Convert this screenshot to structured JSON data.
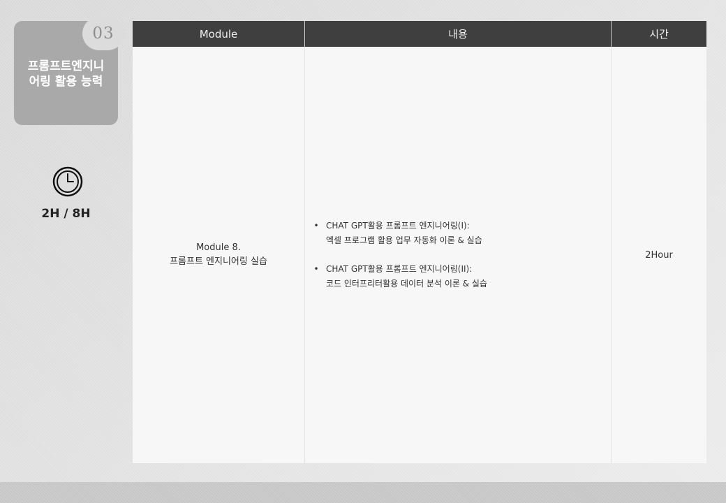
{
  "sidebar": {
    "section_number": "03",
    "title_line1": "프롬프트엔지니",
    "title_line2": "어링 활용 능력",
    "clock_icon": "clock-icon",
    "hours": "2H / 8H"
  },
  "table": {
    "headers": [
      "Module",
      "내용",
      "시간"
    ],
    "row": {
      "module_line1": "Module 8.",
      "module_line2": "프롬프트 엔지니어링 실습",
      "contents": [
        {
          "line1": "CHAT GPT활용 프롬프트 엔지니어링(I):",
          "line2": "엑셀 프로그램 활용 업무 자동화 이론 & 실습"
        },
        {
          "line1": "CHAT GPT활용 프롬프트 엔지니어링(II):",
          "line2": "코드 인터프리터활용 데이터 분석 이론 & 실습"
        }
      ],
      "bullet": "•",
      "time": "2Hour"
    }
  },
  "colors": {
    "header_bg": "#3f3f3f",
    "card_bg": "#a9a9a9",
    "badge_bg": "#dcdcdc"
  }
}
